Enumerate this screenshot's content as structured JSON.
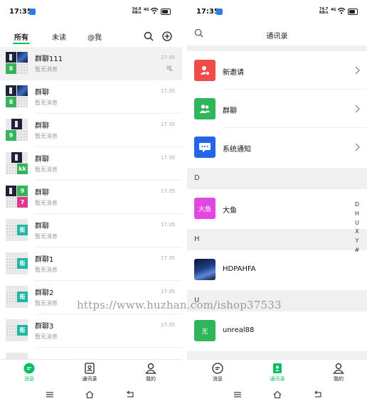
{
  "left_screen": {
    "status_bar": {
      "time": "17:35",
      "net_speed": "54.8\nKB/s",
      "network": "4G"
    },
    "tabs": [
      {
        "label": "所有"
      },
      {
        "label": "未读"
      },
      {
        "label": "@我"
      }
    ],
    "chats": [
      {
        "name": "群聊111",
        "preview": "暂无消息",
        "time": "17:35",
        "tile": "8"
      },
      {
        "name": "群聊",
        "preview": "暂无消息",
        "time": "17:35",
        "tile": "8"
      },
      {
        "name": "群聊",
        "preview": "暂无消息",
        "time": "17:35",
        "tile": "9"
      },
      {
        "name": "群聊",
        "preview": "暂无消息",
        "time": "17:35",
        "tile": "kk"
      },
      {
        "name": "群聊",
        "preview": "暂无消息",
        "time": "17:35",
        "tile": "9",
        "tile2": "7"
      },
      {
        "name": "群聊",
        "preview": "暂无消息",
        "time": "17:35",
        "tile": "街"
      },
      {
        "name": "群聊1",
        "preview": "暂无消息",
        "time": "17:35",
        "tile": "街"
      },
      {
        "name": "群聊2",
        "preview": "暂无消息",
        "time": "17:35",
        "tile": "街"
      },
      {
        "name": "群聊3",
        "preview": "暂无消息",
        "time": "17:35",
        "tile": "街"
      }
    ],
    "bottom_nav": [
      {
        "label": "消息"
      },
      {
        "label": "通讯录"
      },
      {
        "label": "我的"
      }
    ]
  },
  "right_screen": {
    "status_bar": {
      "time": "17:35",
      "net_speed": "74.7\nKB/s",
      "network": "4G"
    },
    "title": "通讯录",
    "entries": [
      {
        "label": "新邀请"
      },
      {
        "label": "群聊"
      },
      {
        "label": "系统通知"
      }
    ],
    "sections": [
      {
        "letter": "D",
        "contacts": [
          {
            "name": "大鱼",
            "avatar_text": "大鱼"
          }
        ]
      },
      {
        "letter": "H",
        "contacts": [
          {
            "name": "HDPAHFA"
          }
        ]
      },
      {
        "letter": "U",
        "contacts": [
          {
            "name": "unreal88",
            "avatar_text": "无"
          }
        ]
      }
    ],
    "index_letters": [
      "D",
      "H",
      "U",
      "X",
      "Y",
      "#"
    ],
    "bottom_nav": [
      {
        "label": "消息"
      },
      {
        "label": "通讯录"
      },
      {
        "label": "我的"
      }
    ]
  },
  "watermark": "https://www.huzhan.com/ishop37533",
  "colors": {
    "accent_green": "#07c160",
    "new_invite": "#f04b4b",
    "group": "#2fb55a",
    "system": "#2566e8",
    "dayu": "#e048e0",
    "unreal": "#2fb55a",
    "tile_green": "#37b35c",
    "tile_teal": "#21b6a4",
    "tile_pink": "#e0388e"
  },
  "icons": [
    "search-icon",
    "add-circle-icon",
    "mute-icon",
    "chat-icon",
    "contacts-icon",
    "profile-icon",
    "chevron-right-icon",
    "new-invite-icon",
    "group-icon",
    "system-notice-icon"
  ]
}
